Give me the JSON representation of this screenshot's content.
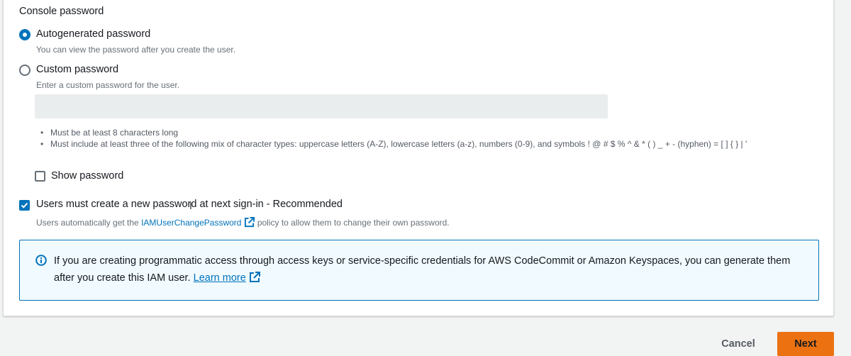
{
  "console_password": {
    "label": "Console password",
    "options": [
      {
        "label": "Autogenerated password",
        "description": "You can view the password after you create the user.",
        "selected": true
      },
      {
        "label": "Custom password",
        "description": "Enter a custom password for the user.",
        "selected": false
      }
    ],
    "password_input": {
      "value": "",
      "placeholder": ""
    },
    "rules": [
      "Must be at least 8 characters long",
      "Must include at least three of the following mix of character types: uppercase letters (A-Z), lowercase letters (a-z), numbers (0-9), and symbols ! @ # $ % ^ & * ( ) _ + - (hyphen) = [ ] { } | '"
    ],
    "show_password": {
      "label": "Show password",
      "checked": false
    }
  },
  "reset_required": {
    "label": "Users must create a new password at next sign-in - Recommended",
    "checked": true,
    "description_prefix": "Users automatically get the ",
    "policy_link": "IAMUserChangePassword",
    "description_suffix": " policy to allow them to change their own password."
  },
  "info_alert": {
    "text": "If you are creating programmatic access through access keys or service-specific credentials for AWS CodeCommit or Amazon Keyspaces, you can generate them after you create this IAM user.",
    "link": "Learn more",
    "icon": "info-icon"
  },
  "footer": {
    "cancel_label": "Cancel",
    "next_label": "Next"
  },
  "colors": {
    "accent": "#0073bb",
    "primary_button": "#ec7211",
    "info_background": "#f1faff"
  }
}
